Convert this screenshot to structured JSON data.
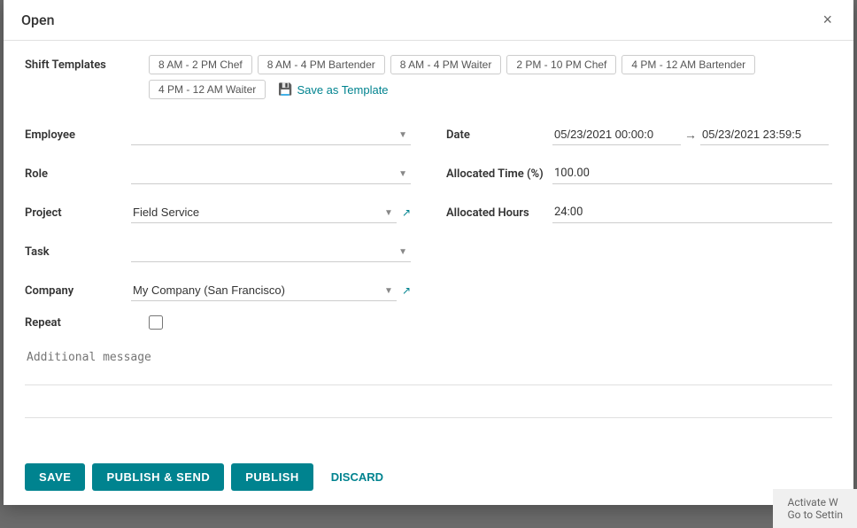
{
  "modal": {
    "title": "Open",
    "close_label": "×"
  },
  "shift_templates": {
    "label": "Shift Templates",
    "templates": [
      "8 AM - 2 PM Chef",
      "8 AM - 4 PM Bartender",
      "8 AM - 4 PM Waiter",
      "2 PM - 10 PM Chef",
      "4 PM - 12 AM Bartender",
      "4 PM - 12 AM Waiter"
    ],
    "save_template_icon": "💾",
    "save_template_label": "Save as Template"
  },
  "form": {
    "employee_label": "Employee",
    "employee_value": "",
    "employee_placeholder": "",
    "role_label": "Role",
    "role_value": "",
    "project_label": "Project",
    "project_value": "Field Service",
    "task_label": "Task",
    "task_value": "",
    "company_label": "Company",
    "company_value": "My Company (San Francisco)",
    "date_label": "Date",
    "date_start": "05/23/2021 00:00:0",
    "date_arrow": "→",
    "date_end": "05/23/2021 23:59:5",
    "allocated_time_label": "Allocated Time (%)",
    "allocated_time_value": "100.00",
    "allocated_hours_label": "Allocated Hours",
    "allocated_hours_value": "24:00",
    "repeat_label": "Repeat",
    "additional_message_placeholder": "Additional message"
  },
  "footer": {
    "save_label": "SAVE",
    "publish_send_label": "PUBLISH & SEND",
    "publish_label": "PUBLISH",
    "discard_label": "DISCARD"
  },
  "watermark": {
    "line1": "Activate W",
    "line2": "Go to Settin"
  }
}
